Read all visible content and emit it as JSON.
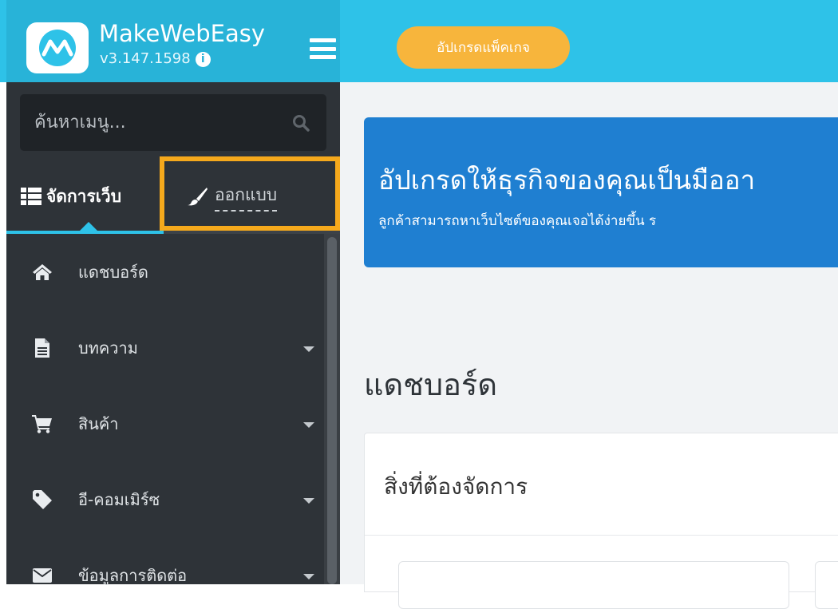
{
  "header": {
    "app_name": "MakeWebEasy",
    "version": "v3.147.1598",
    "upgrade_label": "อัปเกรดแพ็คเกจ",
    "colors": {
      "topbar": "#2ec2e8",
      "upgrade": "#f7b53c"
    }
  },
  "sidebar": {
    "search_placeholder": "ค้นหาเมนู...",
    "tabs": [
      {
        "label": "จัดการเว็บ",
        "icon": "list-icon",
        "active": true
      },
      {
        "label": "ออกแบบ",
        "icon": "paintbrush-icon",
        "active": false
      }
    ],
    "items": [
      {
        "label": "แดชบอร์ด",
        "icon": "home-icon",
        "has_submenu": false
      },
      {
        "label": "บทความ",
        "icon": "file-icon",
        "has_submenu": true
      },
      {
        "label": "สินค้า",
        "icon": "cart-icon",
        "has_submenu": true
      },
      {
        "label": "อี-คอมเมิร์ซ",
        "icon": "tag-icon",
        "has_submenu": true
      },
      {
        "label": "ข้อมูลการติดต่อ",
        "icon": "envelope-icon",
        "has_submenu": true
      }
    ]
  },
  "main": {
    "banner_title": "อัปเกรดให้ธุรกิจของคุณเป็นมืออา",
    "banner_subtitle": "ลูกค้าสามารถหาเว็บไซต์ของคุณเจอได้ง่ายขึ้น ร",
    "page_title": "แดชบอร์ด",
    "card_title": "สิ่งที่ต้องจัดการ"
  }
}
